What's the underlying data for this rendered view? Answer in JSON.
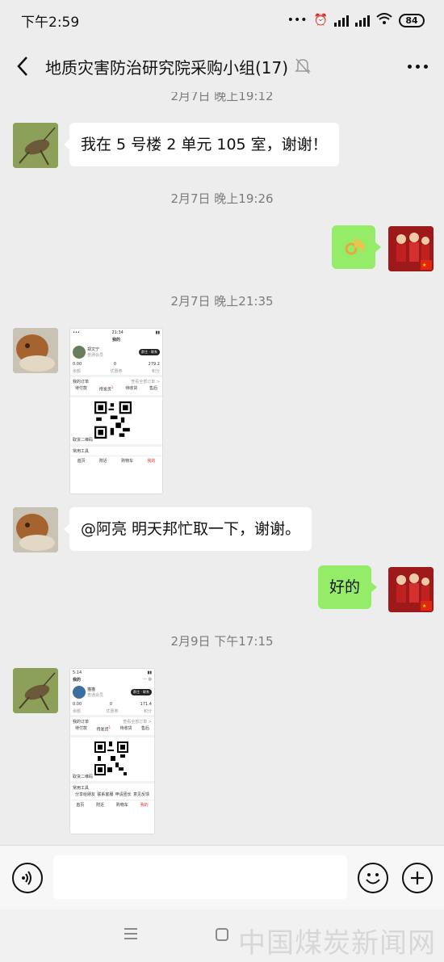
{
  "status_bar": {
    "time": "下午2:59",
    "battery": "84"
  },
  "header": {
    "title": "地质灾害防治研究院采购小组(17)"
  },
  "messages": {
    "ts0": "2月7日 晚上19:12",
    "m1": "我在 5 号楼 2 单元 105 室，谢谢！",
    "ts1": "2月7日 晚上19:26",
    "ts2": "2月7日 晚上21:35",
    "m4": "@阿亮  明天邦忙取一下，谢谢。",
    "m5": "好的",
    "ts3": "2月9日 下午17:15"
  },
  "screenshot1": {
    "title": "我的",
    "name": "郑文宁",
    "tag": "普通会员",
    "pill": "群主 · 联系",
    "stats": [
      "0.00",
      "0",
      "279.2"
    ],
    "stat_labels": [
      "余额",
      "优惠券",
      "积分"
    ],
    "orders_label": "我的订单",
    "orders_more": "查看全部订单 >",
    "order_items": [
      "待付款",
      "待发货",
      "待收货",
      "售后"
    ],
    "badge": "1",
    "qr_label": "取货二维码",
    "tools_label": "常用工具",
    "tabs": [
      "首页",
      "附近",
      "购物车",
      "我的"
    ]
  },
  "screenshot2": {
    "title": "我的",
    "name": "猫猫",
    "tag": "普通会员",
    "pill": "群主 · 联系",
    "stats": [
      "0.00",
      "0",
      "171.4"
    ],
    "stat_labels": [
      "余额",
      "优惠券",
      "积分"
    ],
    "orders_label": "我的订单",
    "orders_more": "查看全部订单 >",
    "order_items": [
      "待付款",
      "待发货",
      "待收货",
      "售后"
    ],
    "badge": "1",
    "qr_label": "取货二维码",
    "tools_label": "常用工具",
    "tool_items": [
      "分享给朋友",
      "联系客服",
      "申请团长",
      "意见反馈"
    ],
    "tabs": [
      "首页",
      "附近",
      "购物车",
      "我的"
    ]
  },
  "input": {
    "placeholder": ""
  },
  "watermark": "中国煤炭新闻网",
  "colors": {
    "accent_green": "#95ec69",
    "background": "#ededed"
  }
}
